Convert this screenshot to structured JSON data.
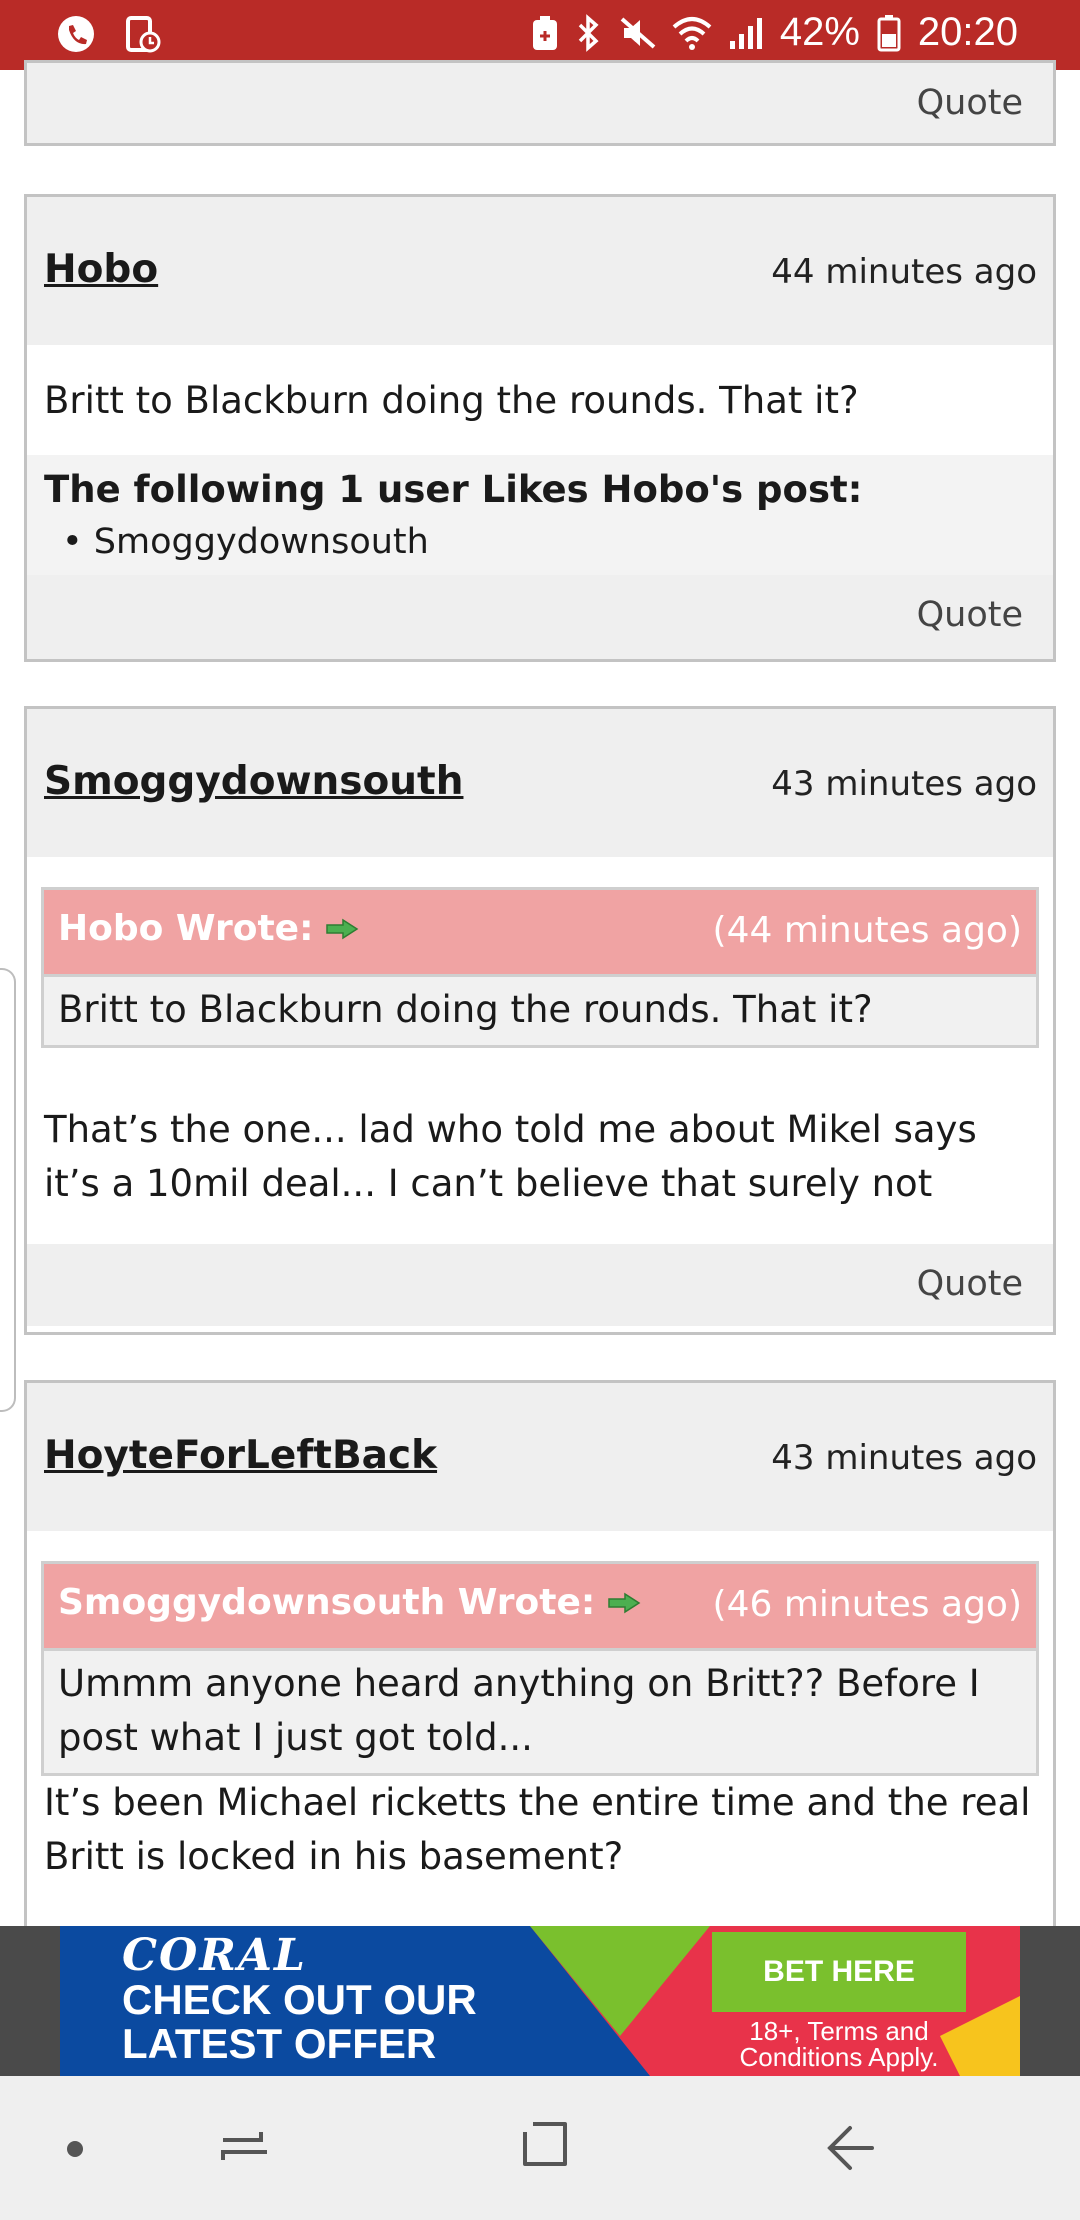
{
  "status_bar": {
    "battery": "42%",
    "time": "20:20",
    "icons": [
      "phone-call-icon",
      "screen-record-icon",
      "alarm-battery-icon",
      "bluetooth-icon",
      "mute-icon",
      "wifi-icon",
      "signal-icon",
      "battery-icon"
    ]
  },
  "top_partial": {
    "quote_label": "Quote"
  },
  "posts": [
    {
      "author": "Hobo",
      "time": "44 minutes ago",
      "body": "Britt to Blackburn doing the rounds. That it?",
      "likes_title": "The following 1 user Likes Hobo's post:",
      "likes_users": [
        "Smoggydownsouth"
      ],
      "quote_label": "Quote"
    },
    {
      "author": "Smoggydownsouth",
      "time": "43 minutes ago",
      "quoted": {
        "author_label": "Hobo Wrote:",
        "time": "(44 minutes ago)",
        "text": "Britt to Blackburn doing the rounds. That it?"
      },
      "body": "That’s the one... lad who told me about Mikel says it’s a 10mil deal... I can’t believe that surely not",
      "quote_label": "Quote"
    },
    {
      "author": "HoyteForLeftBack",
      "time": "43 minutes ago",
      "quoted": {
        "author_label": "Smoggydownsouth Wrote:",
        "time": "(46 minutes ago)",
        "text": "Ummm anyone heard anything on Britt?? Before I post what I just got told..."
      },
      "body": "It’s been Michael ricketts the entire time and the real Britt is locked in his basement?"
    }
  ],
  "ad": {
    "brand": "CORAL",
    "headline_1": "CHECK OUT OUR",
    "headline_2": "LATEST OFFER",
    "cta": "BET HERE",
    "terms_1": "18+, Terms and",
    "terms_2": "Conditions Apply."
  },
  "colors": {
    "status_bar": "#b92b27",
    "quote_header": "#f0a3a3",
    "card_header": "#efefef",
    "ad_blue": "#0b4aa0",
    "ad_green": "#7ac02d",
    "ad_red": "#e8334a"
  },
  "nav": [
    "nav-dot-icon",
    "recent-apps-icon",
    "home-icon",
    "back-icon"
  ]
}
